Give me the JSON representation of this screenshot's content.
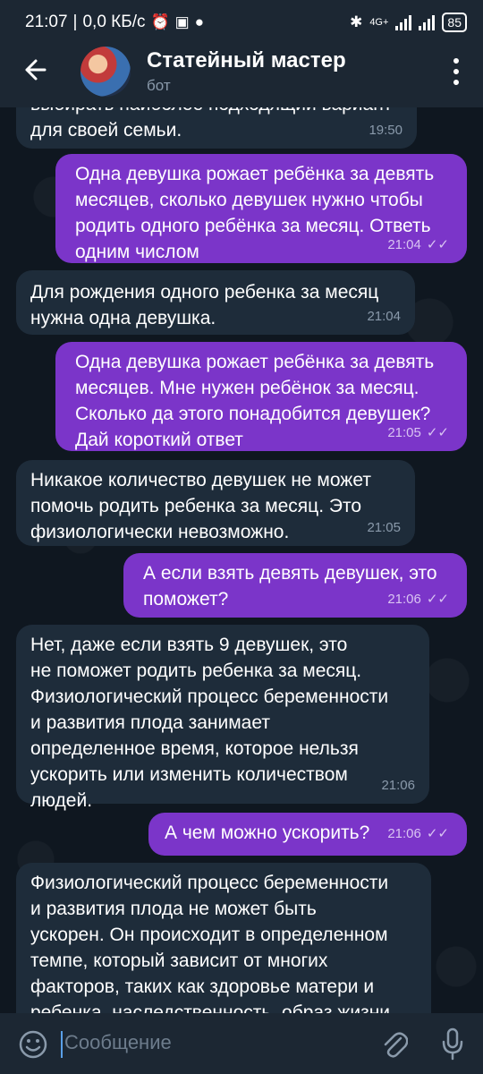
{
  "status_bar": {
    "time": "21:07",
    "speed": "0,0 КБ/с",
    "network": "4G+",
    "battery": "85"
  },
  "header": {
    "title": "Статейный мастер",
    "subtitle": "бот"
  },
  "messages": [
    {
      "dir": "in",
      "text": "выбирать наиболее подходящий вариант\nдля своей семьи.",
      "time": "19:50"
    },
    {
      "dir": "out",
      "text": "Одна девушка рожает ребёнка за девять\nмесяцев, сколько девушек нужно чтобы\nродить одного ребёнка за месяц. Ответь\nодним числом",
      "time": "21:04"
    },
    {
      "dir": "in",
      "text": "Для рождения одного ребенка за месяц\nнужна одна девушка.",
      "time": "21:04"
    },
    {
      "dir": "out",
      "text": "Одна девушка рожает ребёнка за девять\nмесяцев. Мне нужен ребёнок за месяц.\nСколько да этого понадобится девушек?\nДай короткий ответ",
      "time": "21:05"
    },
    {
      "dir": "in",
      "text": "Никакое количество девушек не может\nпомочь родить ребенка за месяц. Это\nфизиологически невозможно.",
      "time": "21:05"
    },
    {
      "dir": "out",
      "text": "А если взять девять девушек, это\nпоможет?",
      "time": "21:06"
    },
    {
      "dir": "in",
      "text": "Нет, даже если взять 9 девушек, это\nне поможет родить ребенка за месяц.\nФизиологический процесс беременности\nи развития плода занимает\nопределенное время, которое нельзя\nускорить или изменить количеством\nлюдей.",
      "time": "21:06"
    },
    {
      "dir": "out",
      "text": "А чем можно ускорить?",
      "time": "21:06"
    },
    {
      "dir": "in",
      "text": "Физиологический процесс беременности\nи развития плода не может быть\nускорен. Он происходит в определенном\nтемпе, который зависит от многих\nфакторов, таких как здоровье матери и\nребенка, наследственность, образ жизни",
      "time": ""
    }
  ],
  "input": {
    "placeholder": "Сообщение"
  },
  "colors": {
    "incoming_bubble": "#1e2c3a",
    "outgoing_bubble": "#7b35c9",
    "header_bg": "#1c2733",
    "chat_bg": "#0f1720"
  },
  "icons": {
    "back": "arrow-left",
    "menu": "three-dots-vertical",
    "emoji": "smiley",
    "attach": "paperclip",
    "mic": "microphone"
  }
}
